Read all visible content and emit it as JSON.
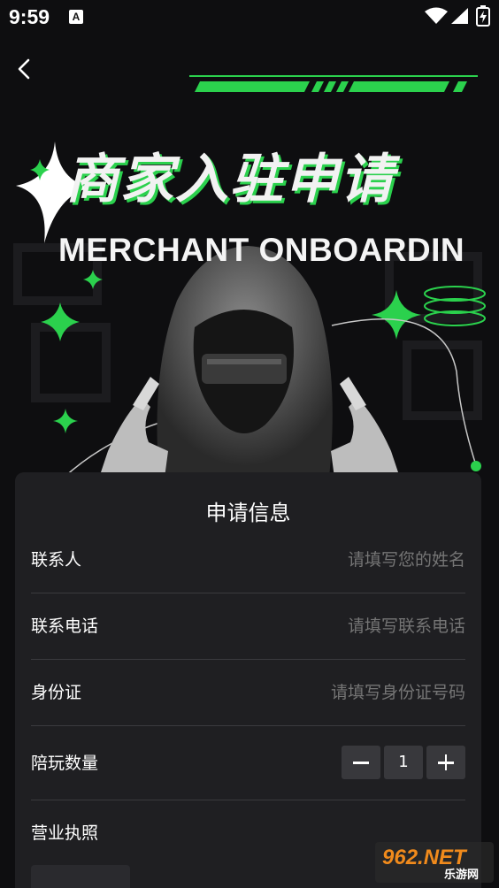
{
  "status_bar": {
    "time": "9:59",
    "notification_icon": "A"
  },
  "hero": {
    "title_cn": "商家入驻申请",
    "title_en": "MERCHANT ONBOARDIN",
    "accent_color": "#2bd14d"
  },
  "form": {
    "title": "申请信息",
    "fields": [
      {
        "label": "联系人",
        "placeholder": "请填写您的姓名"
      },
      {
        "label": "联系电话",
        "placeholder": "请填写联系电话"
      },
      {
        "label": "身份证",
        "placeholder": "请填写身份证号码"
      }
    ],
    "companion_count": {
      "label": "陪玩数量",
      "value": "1"
    },
    "business_license": {
      "label": "营业执照"
    }
  },
  "watermark": {
    "brand": "962.NET",
    "sub": "乐游网"
  }
}
